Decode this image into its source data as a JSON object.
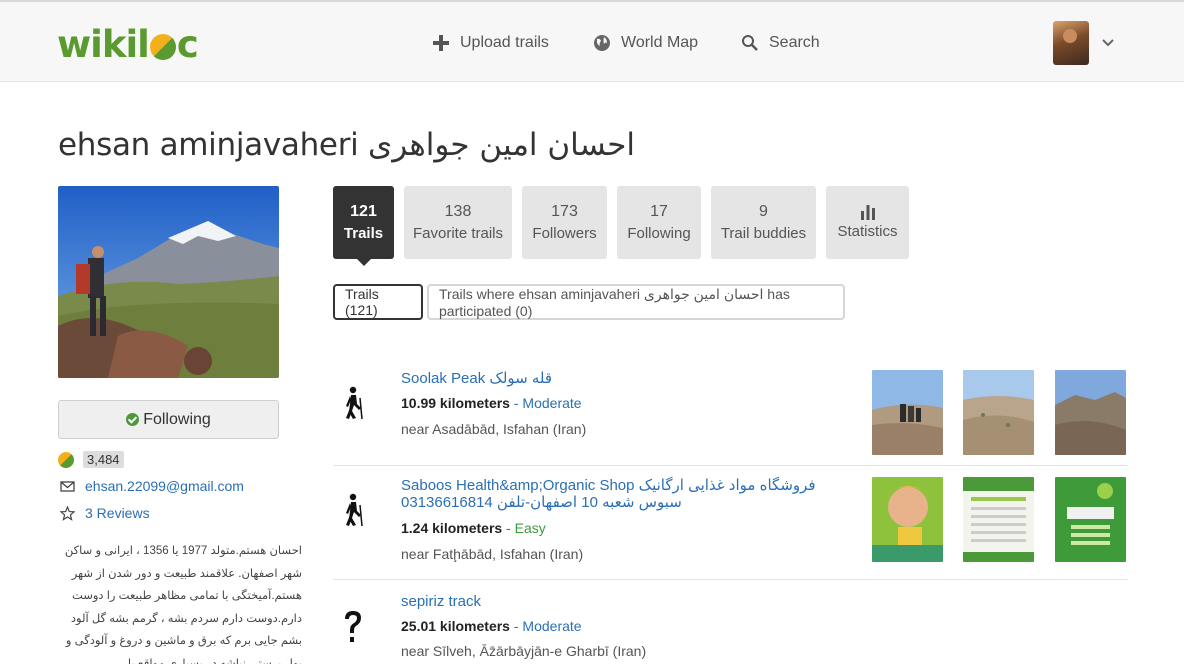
{
  "header": {
    "logo": "wikiloc",
    "nav": {
      "upload": "Upload trails",
      "world_map": "World Map",
      "search": "Search"
    }
  },
  "profile": {
    "name": "ehsan aminjavaheri احسان امین جواهری",
    "follow_label": "Following",
    "score": "3,484",
    "email": "ehsan.22099@gmail.com",
    "reviews": "3 Reviews",
    "bio": "احسان هستم.متولد 1977 یا 1356 ، ایرانی و ساکن شهر اصفهان. علاقمند طبیعت و دور شدن از شهر هستم.آمیختگی با تمامی مظاهر طبیعت را دوست دارم.دوست دارم سردم بشه ، گرمم بشه گل آلود بشم جایی برم که برق و ماشین و دروغ و آلودگی و پول پرستی نباشه.در بسیاری مواقع با"
  },
  "tabs": [
    {
      "count": "121",
      "label": "Trails",
      "active": true
    },
    {
      "count": "138",
      "label": "Favorite trails",
      "active": false
    },
    {
      "count": "173",
      "label": "Followers",
      "active": false
    },
    {
      "count": "17",
      "label": "Following",
      "active": false
    },
    {
      "count": "9",
      "label": "Trail buddies",
      "active": false
    },
    {
      "count": "",
      "label": "Statistics",
      "active": false,
      "icon": "bar-chart-icon"
    }
  ],
  "filters": {
    "trails": "Trails (121)",
    "participated": "Trails where ehsan aminjavaheri احسان امین جواهری has participated (0)"
  },
  "trails": [
    {
      "name": "Soolak Peak قله سولک",
      "distance": "10.99 kilometers",
      "separator": " - ",
      "difficulty": "Moderate",
      "location": "near Asadābād, Isfahan (Iran)",
      "activity_icon": "hiking-icon"
    },
    {
      "name": "Saboos Health&amp;Organic Shop فروشگاه مواد غذایی ارگانیک سبوس شعبه 10 اصفهان-تلفن 03136616814",
      "distance": "1.24 kilometers",
      "separator": " - ",
      "difficulty": "Easy",
      "location": "near Fatḩābād, Isfahan (Iran)",
      "activity_icon": "hiking-icon"
    },
    {
      "name": "sepiriz track",
      "distance": "25.01 kilometers",
      "separator": " - ",
      "difficulty": "Moderate",
      "location": "near Sīlveh, Āz̄ārbāyjān-e Gharbī (Iran)",
      "activity_icon": "question-mark-icon"
    }
  ],
  "colors": {
    "brand_green": "#5a9a2e",
    "brand_orange": "#f2b01e",
    "link_blue": "#2a6fb5",
    "active_tab": "#333333",
    "tab_bg": "#e5e5e5",
    "easy_green": "#3c9a3c"
  }
}
